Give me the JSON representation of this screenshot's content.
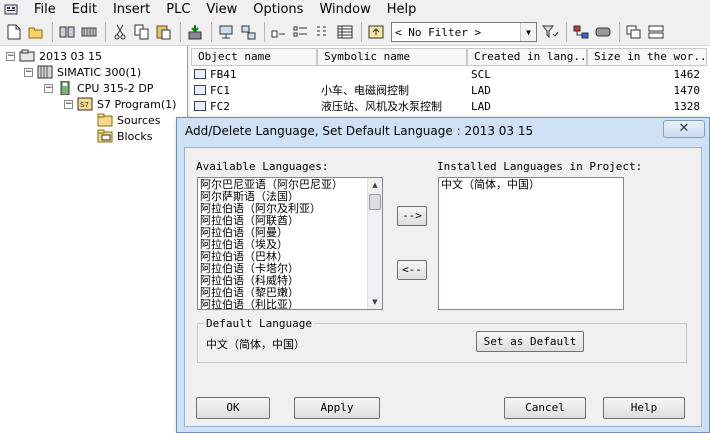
{
  "menubar": {
    "items": [
      "File",
      "Edit",
      "Insert",
      "PLC",
      "View",
      "Options",
      "Window",
      "Help"
    ]
  },
  "toolbar": {
    "filter_value": "< No Filter >"
  },
  "tree": {
    "nodes": [
      {
        "label": "2013 03 15",
        "toggle": "−"
      },
      {
        "label": "SIMATIC 300(1)",
        "toggle": "−"
      },
      {
        "label": "CPU 315-2 DP",
        "toggle": "−"
      },
      {
        "label": "S7 Program(1)",
        "toggle": "−"
      },
      {
        "label": "Sources",
        "toggle": ""
      },
      {
        "label": "Blocks",
        "toggle": ""
      }
    ]
  },
  "object_list": {
    "headers": [
      "Object name",
      "Symbolic name",
      "Created in lang...",
      "Size in the wor..."
    ],
    "rows": [
      {
        "name": "FB41",
        "symbolic": "",
        "lang": "SCL",
        "size": "1462"
      },
      {
        "name": "FC1",
        "symbolic": "小车、电磁阀控制",
        "lang": "LAD",
        "size": "1470"
      },
      {
        "name": "FC2",
        "symbolic": "液压站、风机及水泵控制",
        "lang": "LAD",
        "size": "1328"
      }
    ]
  },
  "dialog": {
    "title": "Add/Delete Language, Set Default Language : 2013 03 15",
    "close_symbol": "✕",
    "available_label": "Available Languages:",
    "installed_label": "Installed Languages in Project:",
    "available_languages": [
      "阿尔巴尼亚语（阿尔巴尼亚）",
      "阿尔萨斯语（法国）",
      "阿拉伯语（阿尔及利亚）",
      "阿拉伯语（阿联酋）",
      "阿拉伯语（阿曼）",
      "阿拉伯语（埃及）",
      "阿拉伯语（巴林）",
      "阿拉伯语（卡塔尔）",
      "阿拉伯语（科威特）",
      "阿拉伯语（黎巴嫩）",
      "阿拉伯语（利比亚）"
    ],
    "installed_languages": [
      "中文（简体，中国）"
    ],
    "add_button": "-->",
    "remove_button": "<--",
    "default_group_label": "Default Language",
    "default_language_value": "中文（简体，中国）",
    "set_default_button": "Set as Default",
    "ok_button": "OK",
    "apply_button": "Apply",
    "cancel_button": "Cancel",
    "help_button": "Help"
  }
}
